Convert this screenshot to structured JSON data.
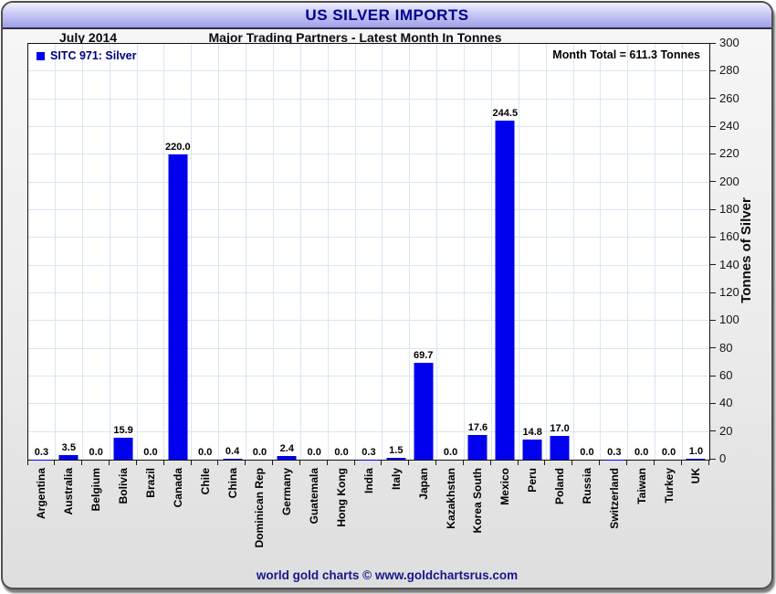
{
  "header": {
    "title": "US SILVER IMPORTS",
    "date_label": "July 2014",
    "subtitle": "Major Trading Partners - Latest Month In Tonnes"
  },
  "legend": {
    "label": "SITC 971: Silver"
  },
  "annotations": {
    "month_total": "Month Total = 611.3 Tonnes"
  },
  "footer": {
    "credit": "world gold charts © www.goldchartsrus.com"
  },
  "colors": {
    "bar": "#0000ee",
    "grid": "#d9e5f3",
    "title_text": "#00008b",
    "legend_text": "#000080",
    "footer_text": "#16168c"
  },
  "chart_data": {
    "type": "bar",
    "title": "US SILVER IMPORTS",
    "subtitle": "Major Trading Partners - Latest Month In Tonnes",
    "period": "July 2014",
    "series_name": "SITC 971: Silver",
    "categories": [
      "Argentina",
      "Australia",
      "Belgium",
      "Bolivia",
      "Brazil",
      "Canada",
      "Chile",
      "China",
      "Dominican Rep",
      "Germany",
      "Guatemala",
      "Hong Kong",
      "India",
      "Italy",
      "Japan",
      "Kazakhstan",
      "Korea South",
      "Mexico",
      "Peru",
      "Poland",
      "Russia",
      "Switzerland",
      "Taiwan",
      "Turkey",
      "UK"
    ],
    "values": [
      0.3,
      3.5,
      0.0,
      15.9,
      0.0,
      220.0,
      0.0,
      0.4,
      0.0,
      2.4,
      0.0,
      0.0,
      0.3,
      1.5,
      69.7,
      0.0,
      17.6,
      244.5,
      14.8,
      17.0,
      0.0,
      0.3,
      0.0,
      0.0,
      1.0
    ],
    "month_total": 611.3,
    "value_label_decimals": 1,
    "xlabel": "",
    "ylabel": "Tonnes of Silver",
    "ylim": [
      0,
      300
    ],
    "ytick_step": 20,
    "grid": true,
    "legend_position": "top-left",
    "y_axis_side": "right"
  }
}
